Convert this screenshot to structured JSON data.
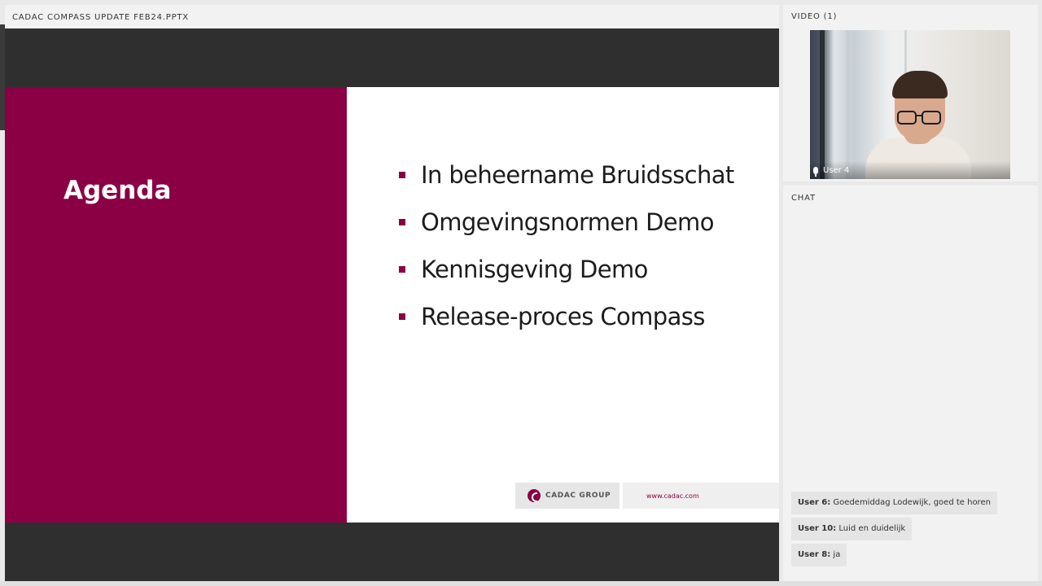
{
  "presentation": {
    "header": "CADAC COMPASS UPDATE FEB24.PPTX",
    "slide": {
      "title": "Agenda",
      "bullets": [
        "In beheername Bruidsschat",
        "Omgevingsnormen Demo",
        "Kennisgeving Demo",
        "Release-proces Compass"
      ],
      "logo_text": "CADAC GROUP",
      "url": "www.cadac.com",
      "accent_color": "#8b0045"
    }
  },
  "video": {
    "header": "VIDEO (1)",
    "participant": "User 4"
  },
  "chat": {
    "header": "CHAT",
    "messages": [
      {
        "user": "User 6:",
        "text": "Goedemiddag Lodewijk, goed te horen"
      },
      {
        "user": "User 10:",
        "text": "Luid en duidelijk"
      },
      {
        "user": "User 8:",
        "text": "ja"
      }
    ]
  }
}
